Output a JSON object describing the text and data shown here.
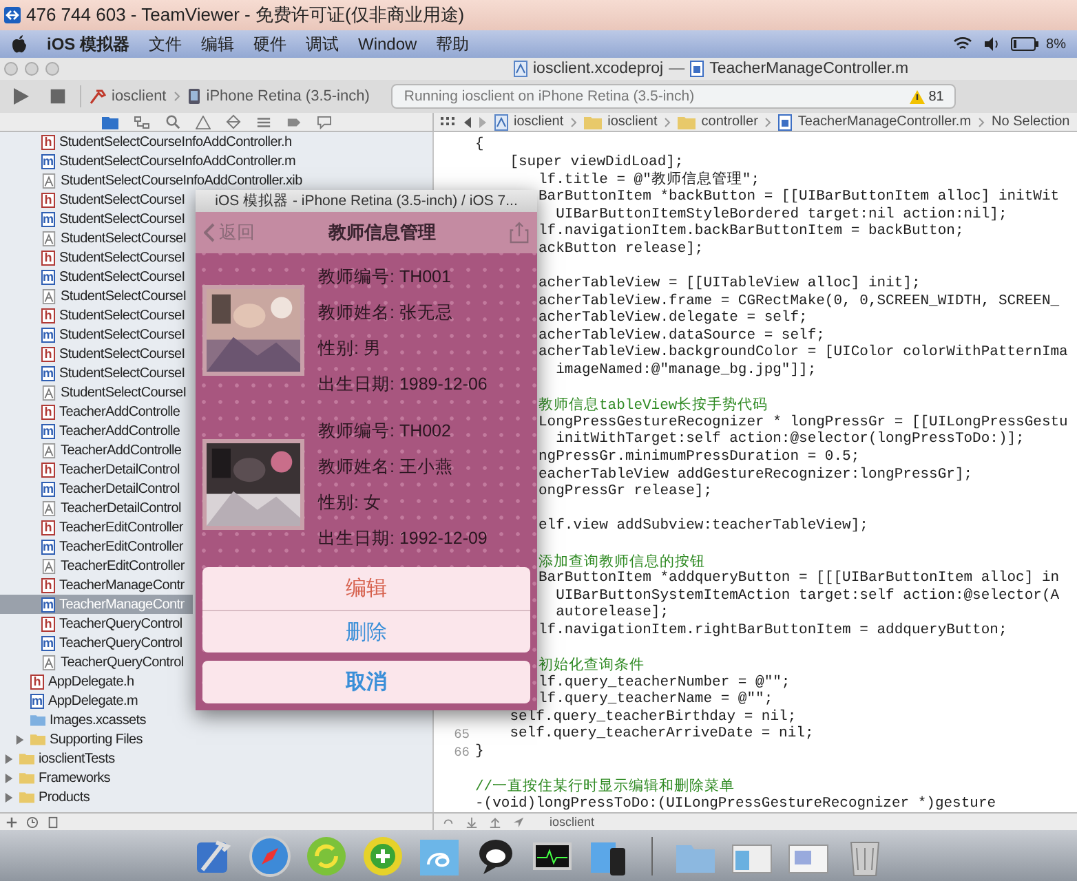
{
  "teamviewer": {
    "title": "476 744 603 - TeamViewer - 免费许可证(仅非商业用途)"
  },
  "menu_bar": {
    "items": [
      "iOS 模拟器",
      "文件",
      "编辑",
      "硬件",
      "调试",
      "Window",
      "帮助"
    ],
    "battery": "8%"
  },
  "xcode": {
    "title": {
      "project": "iosclient.xcodeproj",
      "separator": "—",
      "file": "TeacherManageController.m"
    },
    "toolbar": {
      "scheme": "iosclient",
      "device": "iPhone Retina (3.5-inch)",
      "status": "Running iosclient on iPhone Retina (3.5-inch)",
      "warnings": "81"
    },
    "jump_bar": [
      {
        "label": "iosclient",
        "kind": "project"
      },
      {
        "label": "iosclient",
        "kind": "folder"
      },
      {
        "label": "controller",
        "kind": "folder"
      },
      {
        "label": "TeacherManageController.m",
        "kind": "file"
      },
      {
        "label": "No Selection",
        "kind": "text"
      }
    ],
    "navigator": {
      "tree": [
        {
          "children": [
            {
              "children": [
                {
                  "label": "StudentSelectCourseInfoAddController.h",
                  "kind": "code_file",
                  "icon_letter": "h",
                  "color": "#b03a36",
                  "selected": false
                },
                {
                  "label": "StudentSelectCourseInfoAddController.m",
                  "kind": "code_file",
                  "icon_letter": "m",
                  "color": "#2f5fb3",
                  "selected": false
                },
                {
                  "label": "StudentSelectCourseInfoAddController.xib",
                  "kind": "interface_file",
                  "selected": false
                },
                {
                  "label": "StudentSelectCourseI",
                  "kind": "code_file",
                  "icon_letter": "h",
                  "color": "#b03a36",
                  "selected": false
                },
                {
                  "label": "StudentSelectCourseI",
                  "kind": "code_file",
                  "icon_letter": "m",
                  "color": "#2f5fb3",
                  "selected": false
                },
                {
                  "label": "StudentSelectCourseI",
                  "kind": "interface_file",
                  "selected": false
                },
                {
                  "label": "StudentSelectCourseI",
                  "kind": "code_file",
                  "icon_letter": "h",
                  "color": "#b03a36",
                  "selected": false
                },
                {
                  "label": "StudentSelectCourseI",
                  "kind": "code_file",
                  "icon_letter": "m",
                  "color": "#2f5fb3",
                  "selected": false
                },
                {
                  "label": "StudentSelectCourseI",
                  "kind": "interface_file",
                  "selected": false
                },
                {
                  "label": "StudentSelectCourseI",
                  "kind": "code_file",
                  "icon_letter": "h",
                  "color": "#b03a36",
                  "selected": false
                },
                {
                  "label": "StudentSelectCourseI",
                  "kind": "code_file",
                  "icon_letter": "m",
                  "color": "#2f5fb3",
                  "selected": false
                },
                {
                  "label": "StudentSelectCourseI",
                  "kind": "code_file",
                  "icon_letter": "h",
                  "color": "#b03a36",
                  "selected": false
                },
                {
                  "label": "StudentSelectCourseI",
                  "kind": "code_file",
                  "icon_letter": "m",
                  "color": "#2f5fb3",
                  "selected": false
                },
                {
                  "label": "StudentSelectCourseI",
                  "kind": "interface_file",
                  "selected": false
                },
                {
                  "label": "TeacherAddControlle",
                  "kind": "code_file",
                  "icon_letter": "h",
                  "color": "#b03a36",
                  "selected": false
                },
                {
                  "label": "TeacherAddControlle",
                  "kind": "code_file",
                  "icon_letter": "m",
                  "color": "#2f5fb3",
                  "selected": false
                },
                {
                  "label": "TeacherAddControlle",
                  "kind": "interface_file",
                  "selected": false
                },
                {
                  "label": "TeacherDetailControl",
                  "kind": "code_file",
                  "icon_letter": "h",
                  "color": "#b03a36",
                  "selected": false
                },
                {
                  "label": "TeacherDetailControl",
                  "kind": "code_file",
                  "icon_letter": "m",
                  "color": "#2f5fb3",
                  "selected": false
                },
                {
                  "label": "TeacherDetailControl",
                  "kind": "interface_file",
                  "selected": false
                },
                {
                  "label": "TeacherEditController",
                  "kind": "code_file",
                  "icon_letter": "h",
                  "color": "#b03a36",
                  "selected": false
                },
                {
                  "label": "TeacherEditController",
                  "kind": "code_file",
                  "icon_letter": "m",
                  "color": "#2f5fb3",
                  "selected": false
                },
                {
                  "label": "TeacherEditController",
                  "kind": "interface_file",
                  "selected": false
                },
                {
                  "label": "TeacherManageContr",
                  "kind": "code_file",
                  "icon_letter": "h",
                  "color": "#b03a36",
                  "selected": false
                },
                {
                  "label": "TeacherManageContr",
                  "kind": "code_file",
                  "icon_letter": "m",
                  "color": "#2f5fb3",
                  "selected": true
                },
                {
                  "label": "TeacherQueryControl",
                  "kind": "code_file",
                  "icon_letter": "h",
                  "color": "#b03a36",
                  "selected": false
                },
                {
                  "label": "TeacherQueryControl",
                  "kind": "code_file",
                  "icon_letter": "m",
                  "color": "#2f5fb3",
                  "selected": false
                },
                {
                  "label": "TeacherQueryControl",
                  "kind": "interface_file",
                  "selected": false
                }
              ]
            },
            {
              "label": "AppDelegate.h",
              "kind": "code_file",
              "icon_letter": "h",
              "color": "#b03a36",
              "selected": false
            },
            {
              "label": "AppDelegate.m",
              "kind": "code_file",
              "icon_letter": "m",
              "color": "#2f5fb3",
              "selected": false
            },
            {
              "label": "Images.xcassets",
              "kind": "assets",
              "selected": false
            },
            {
              "label": "Supporting Files",
              "kind": "folder",
              "expanded": false,
              "selected": false
            }
          ]
        },
        {
          "label": "iosclientTests",
          "kind": "folder",
          "expanded": false,
          "selected": false
        },
        {
          "label": "Frameworks",
          "kind": "folder",
          "expanded": false,
          "selected": false
        },
        {
          "label": "Products",
          "kind": "folder",
          "expanded": false,
          "selected": false
        }
      ]
    },
    "editor": {
      "lines_top": [
        {
          "kind": "code",
          "text": "{"
        },
        {
          "kind": "code",
          "text": "    [super viewDidLoad];"
        }
      ],
      "lines_behind_simulator": [
        {
          "kind": "code",
          "text": "lf.title = @\"教师信息管理\";"
        },
        {
          "kind": "code",
          "text": "BarButtonItem *backButton = [[UIBarButtonItem alloc] initWit"
        },
        {
          "kind": "code",
          "text": "  UIBarButtonItemStyleBordered target:nil action:nil];"
        },
        {
          "kind": "code",
          "text": "lf.navigationItem.backBarButtonItem = backButton;"
        },
        {
          "kind": "code",
          "text": "ackButton release];"
        },
        {
          "kind": "blank"
        },
        {
          "kind": "code",
          "text": "acherTableView = [[UITableView alloc] init];"
        },
        {
          "kind": "code",
          "text": "acherTableView.frame = CGRectMake(0, 0,SCREEN_WIDTH, SCREEN_"
        },
        {
          "kind": "code",
          "text": "acherTableView.delegate = self;"
        },
        {
          "kind": "code",
          "text": "acherTableView.dataSource = self;"
        },
        {
          "kind": "code",
          "text": "acherTableView.backgroundColor = [UIColor colorWithPatternIma"
        },
        {
          "kind": "code",
          "text": "  imageNamed:@\"manage_bg.jpg\"]];"
        },
        {
          "kind": "blank"
        },
        {
          "kind": "comment",
          "text": "教师信息tableView长按手势代码"
        },
        {
          "kind": "code",
          "text": "LongPressGestureRecognizer * longPressGr = [[UILongPressGestu"
        },
        {
          "kind": "code",
          "text": "  initWithTarget:self action:@selector(longPressToDo:)];"
        },
        {
          "kind": "code",
          "text": "ngPressGr.minimumPressDuration = 0.5;"
        },
        {
          "kind": "code",
          "text": "eacherTableView addGestureRecognizer:longPressGr];"
        },
        {
          "kind": "code",
          "text": "ongPressGr release];"
        },
        {
          "kind": "blank"
        },
        {
          "kind": "code",
          "text": "elf.view addSubview:teacherTableView];"
        },
        {
          "kind": "blank"
        },
        {
          "kind": "comment",
          "text": "添加查询教师信息的按钮"
        },
        {
          "kind": "code",
          "text": "BarButtonItem *addqueryButton = [[[UIBarButtonItem alloc] in"
        },
        {
          "kind": "code",
          "text": "  UIBarButtonSystemItemAction target:self action:@selector(A"
        },
        {
          "kind": "code",
          "text": "  autorelease];"
        },
        {
          "kind": "code",
          "text": "lf.navigationItem.rightBarButtonItem = addqueryButton;"
        },
        {
          "kind": "blank"
        },
        {
          "kind": "comment",
          "text": "初始化查询条件"
        },
        {
          "kind": "code",
          "text": "lf.query_teacherNumber = @\"\";"
        },
        {
          "kind": "code",
          "text": "lf.query_teacherName = @\"\";"
        }
      ],
      "lines_bottom": [
        {
          "kind": "code",
          "text": "    self.query_teacherBirthday = nil;"
        },
        {
          "kind": "code",
          "number": "65",
          "text": "    self.query_teacherArriveDate = nil;"
        },
        {
          "kind": "code",
          "number": "66",
          "text": "}"
        },
        {
          "kind": "blank"
        },
        {
          "kind": "comment",
          "text": "//一直按住某行时显示编辑和删除菜单"
        },
        {
          "kind": "code",
          "text": "-(void)longPressToDo:(UILongPressGestureRecognizer *)gesture"
        }
      ]
    },
    "debug_bar": {
      "target": "iosclient"
    }
  },
  "simulator": {
    "title": "iOS 模拟器 - iPhone Retina (3.5-inch) / iOS 7...",
    "nav": {
      "back": "返回",
      "title": "教师信息管理"
    },
    "teachers": [
      {
        "fields": [
          "教师编号: TH001",
          "教师姓名: 张无忌",
          "性别: 男",
          "出生日期: 1989-12-06"
        ]
      },
      {
        "fields": [
          "教师编号: TH002",
          "教师姓名: 王小燕",
          "性别: 女",
          "出生日期: 1992-12-09"
        ]
      }
    ],
    "action_sheet": [
      {
        "label": "编辑",
        "kind": "destructive"
      },
      {
        "label": "删除",
        "kind": "default"
      },
      {
        "label": "取消",
        "kind": "cancel"
      }
    ]
  }
}
